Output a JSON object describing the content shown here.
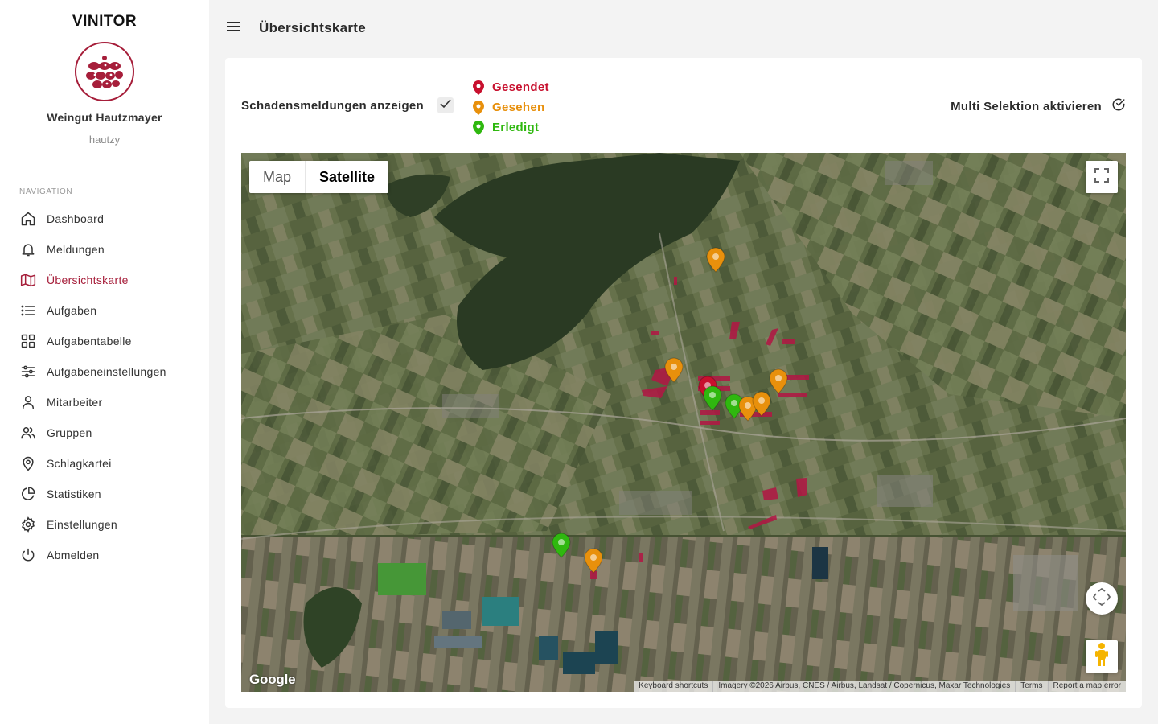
{
  "sidebar": {
    "brand": "VINITOR",
    "org_name": "Weingut Hautzmayer",
    "username": "hautzy",
    "nav_heading": "NAVIGATION",
    "items": [
      {
        "label": "Dashboard",
        "icon": "home-icon"
      },
      {
        "label": "Meldungen",
        "icon": "bell-icon"
      },
      {
        "label": "Übersichtskarte",
        "icon": "map-icon",
        "active": true
      },
      {
        "label": "Aufgaben",
        "icon": "list-icon"
      },
      {
        "label": "Aufgabentabelle",
        "icon": "grid-icon"
      },
      {
        "label": "Aufgabeneinstellungen",
        "icon": "sliders-icon"
      },
      {
        "label": "Mitarbeiter",
        "icon": "user-icon"
      },
      {
        "label": "Gruppen",
        "icon": "users-icon"
      },
      {
        "label": "Schlagkartei",
        "icon": "map-pin-icon"
      },
      {
        "label": "Statistiken",
        "icon": "pie-chart-icon"
      },
      {
        "label": "Einstellungen",
        "icon": "gear-icon"
      },
      {
        "label": "Abmelden",
        "icon": "power-icon"
      }
    ]
  },
  "header": {
    "title": "Übersichtskarte"
  },
  "controls": {
    "show_damage_label": "Schadensmeldungen anzeigen",
    "show_damage_checked": true,
    "legend": [
      {
        "label": "Gesendet",
        "color": "#c8102e"
      },
      {
        "label": "Gesehen",
        "color": "#e8900c"
      },
      {
        "label": "Erledigt",
        "color": "#2fb80f"
      }
    ],
    "multi_select_label": "Multi Selektion aktivieren"
  },
  "map": {
    "type_options": [
      "Map",
      "Satellite"
    ],
    "selected_type": "Satellite",
    "google_logo": "Google",
    "attribution": {
      "shortcuts": "Keyboard shortcuts",
      "imagery": "Imagery ©2026 Airbus, CNES / Airbus, Landsat / Copernicus, Maxar Technologies",
      "terms": "Terms",
      "report": "Report a map error"
    },
    "markers": [
      {
        "status": "gesehen"
      },
      {
        "status": "gesehen"
      },
      {
        "status": "gesendet"
      },
      {
        "status": "erledigt"
      },
      {
        "status": "erledigt"
      },
      {
        "status": "gesehen"
      },
      {
        "status": "gesehen"
      },
      {
        "status": "gesehen"
      },
      {
        "status": "erledigt"
      },
      {
        "status": "gesehen"
      }
    ]
  },
  "colors": {
    "accent": "#a61e3a",
    "gesendet": "#c8102e",
    "gesehen": "#e8900c",
    "erledigt": "#2fb80f"
  }
}
